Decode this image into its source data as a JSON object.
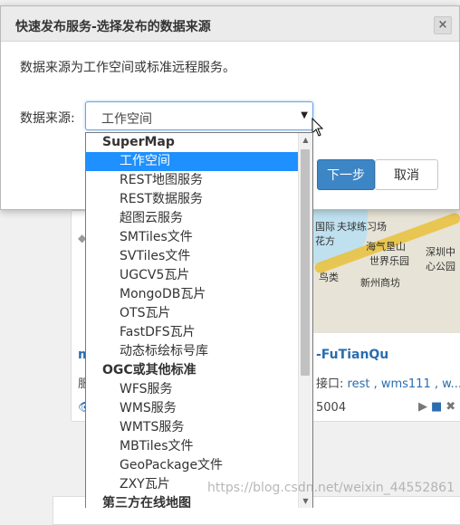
{
  "background": {
    "map_labels": [
      "国际",
      "夫球练习场",
      "花方",
      "海气垦山",
      "深圳中",
      "心公园",
      "世界乐园",
      "新州商坊",
      "鸟类"
    ],
    "service_title_right": "-FuTianQu",
    "service_title_left": "m",
    "left_char": "服",
    "interface_label": "接口: ",
    "interface_links": "rest , wms111 , w...",
    "port_text": "5004"
  },
  "modal": {
    "title": "快速发布服务-选择发布的数据来源",
    "close_label": "×",
    "description": "数据来源为工作空间或标准远程服务。",
    "source_label": "数据来源:",
    "select_value": "工作空间",
    "next_label": "下一步",
    "cancel_label": "取消"
  },
  "dropdown": {
    "items": [
      {
        "type": "group",
        "label": "SuperMap"
      },
      {
        "type": "option",
        "label": "工作空间",
        "selected": true
      },
      {
        "type": "option",
        "label": "REST地图服务"
      },
      {
        "type": "option",
        "label": "REST数据服务"
      },
      {
        "type": "option",
        "label": "超图云服务"
      },
      {
        "type": "option",
        "label": "SMTiles文件"
      },
      {
        "type": "option",
        "label": "SVTiles文件"
      },
      {
        "type": "option",
        "label": "UGCV5瓦片"
      },
      {
        "type": "option",
        "label": "MongoDB瓦片"
      },
      {
        "type": "option",
        "label": "OTS瓦片"
      },
      {
        "type": "option",
        "label": "FastDFS瓦片"
      },
      {
        "type": "option",
        "label": "动态标绘标号库"
      },
      {
        "type": "group",
        "label": "OGC或其他标准"
      },
      {
        "type": "option",
        "label": "WFS服务"
      },
      {
        "type": "option",
        "label": "WMS服务"
      },
      {
        "type": "option",
        "label": "WMTS服务"
      },
      {
        "type": "option",
        "label": "MBTiles文件"
      },
      {
        "type": "option",
        "label": "GeoPackage文件"
      },
      {
        "type": "option",
        "label": "ZXY瓦片"
      },
      {
        "type": "group",
        "label": "第三方在线地图"
      }
    ]
  },
  "watermark": "https://blog.csdn.net/weixin_44552861"
}
